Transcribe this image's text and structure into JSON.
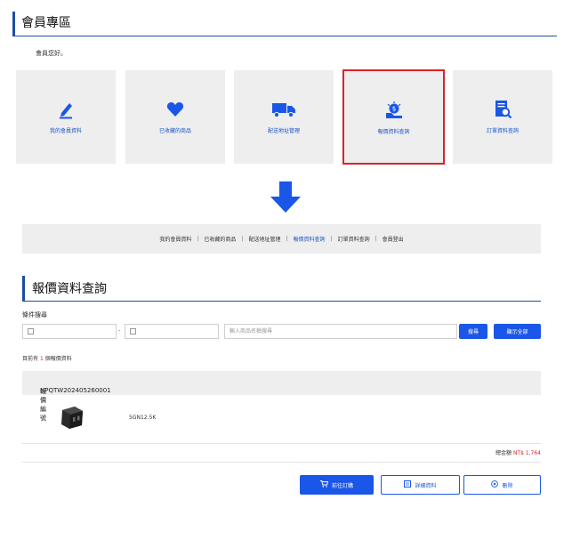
{
  "header": {
    "title": "會員專區"
  },
  "greeting": "會員您好。",
  "cards": [
    {
      "label": "我的會員資料",
      "icon": "pencil-icon"
    },
    {
      "label": "已收藏的商品",
      "icon": "heart-icon"
    },
    {
      "label": "配送地址管理",
      "icon": "truck-icon"
    },
    {
      "label": "報價資料查詢",
      "icon": "quote-icon"
    },
    {
      "label": "訂單資料查詢",
      "icon": "order-search-icon"
    }
  ],
  "nav": {
    "items": [
      "我的會員資料",
      "已收藏的商品",
      "配送地址管理",
      "報價資料查詢",
      "訂單資料查詢",
      "會員登出"
    ],
    "separator": "|",
    "current": "報價資料查詢"
  },
  "page": {
    "title": "報價資料查詢"
  },
  "filter": {
    "label": "條件搜尋",
    "date_separator": "-",
    "search_placeholder": "輸入商品名稱搜尋",
    "search_button": "搜尋",
    "show_all_button": "顯示全部"
  },
  "results": {
    "prefix": "目前有",
    "count": "1",
    "suffix": "個報價資料"
  },
  "quote": {
    "number_label": "報價編號",
    "number": "HPQTW202405260001",
    "product_name": "5GN12.5K",
    "total_label": "總金額",
    "total_amount": "NT$ 1,764"
  },
  "actions": {
    "order": "前往訂購",
    "detail": "詳細資料",
    "delete": "刪除"
  },
  "colors": {
    "accent": "#1a56e8",
    "highlight": "#d9232a",
    "panel": "#eeeeee"
  }
}
